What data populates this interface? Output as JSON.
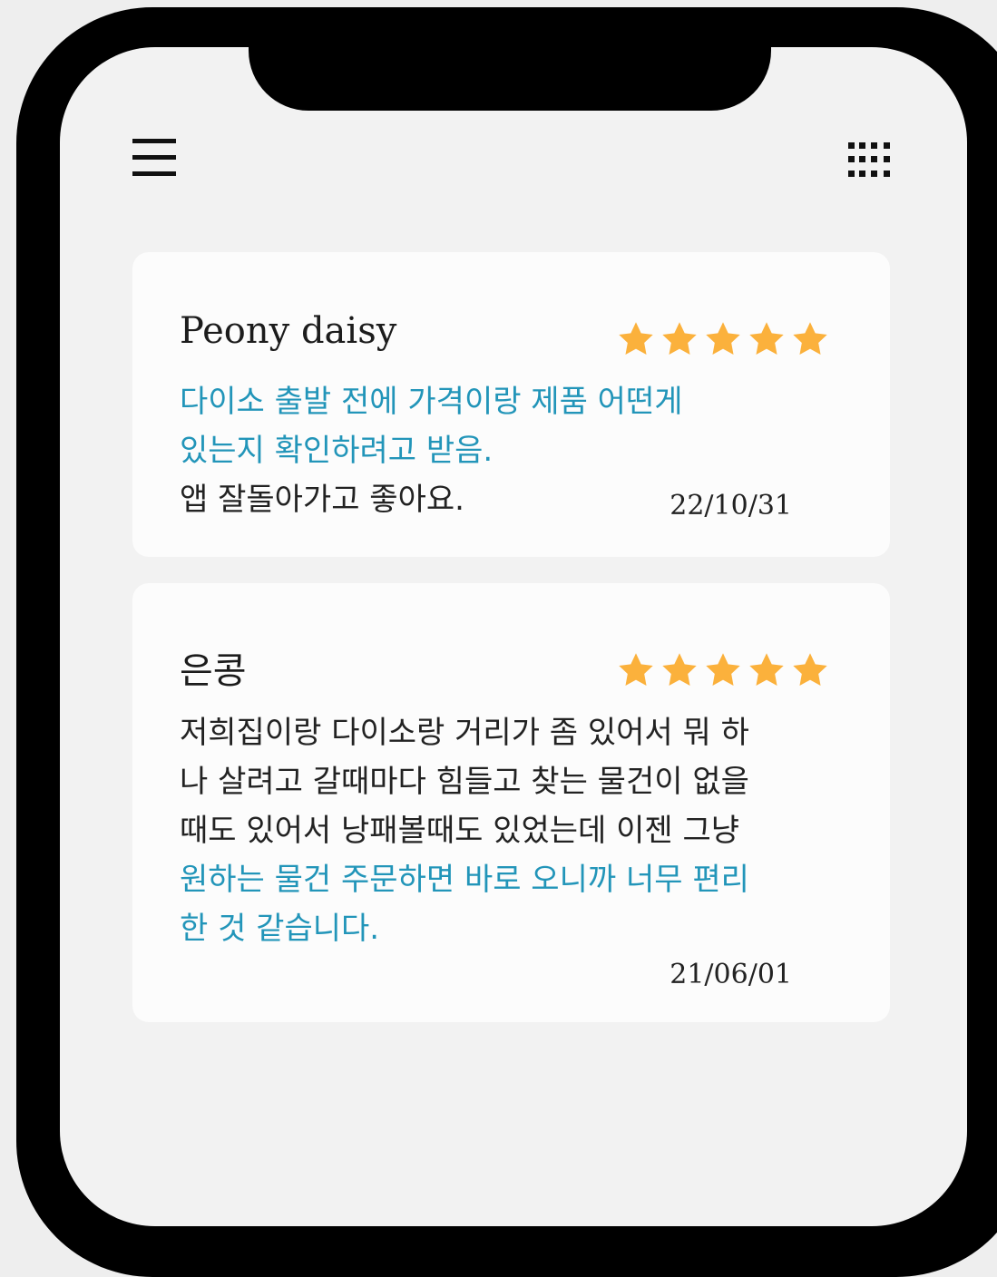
{
  "toolbar": {
    "menu_icon": "hamburger-menu-icon",
    "grid_icon": "grid-dots-icon"
  },
  "colors": {
    "highlight_text": "#2295b9",
    "star": "#fbb13c",
    "frame": "#000000"
  },
  "reviews": [
    {
      "author": "Peony daisy",
      "rating": 5,
      "max_rating": 5,
      "lines": [
        "다이소 출발 전에 가격이랑 제품 어떤게",
        "있는지 확인하려고 받음.",
        "앱 잘돌아가고 좋아요."
      ],
      "date": "22/10/31"
    },
    {
      "author": "은콩",
      "rating": 5,
      "max_rating": 5,
      "lines": [
        "저희집이랑 다이소랑 거리가 좀 있어서 뭐 하",
        "나 살려고 갈때마다 힘들고 찾는 물건이 없을",
        "때도 있어서 낭패볼때도 있었는데 이젠 그냥",
        "원하는 물건 주문하면 바로 오니까 너무 편리",
        "한 것 같습니다."
      ],
      "date": "21/06/01"
    }
  ]
}
